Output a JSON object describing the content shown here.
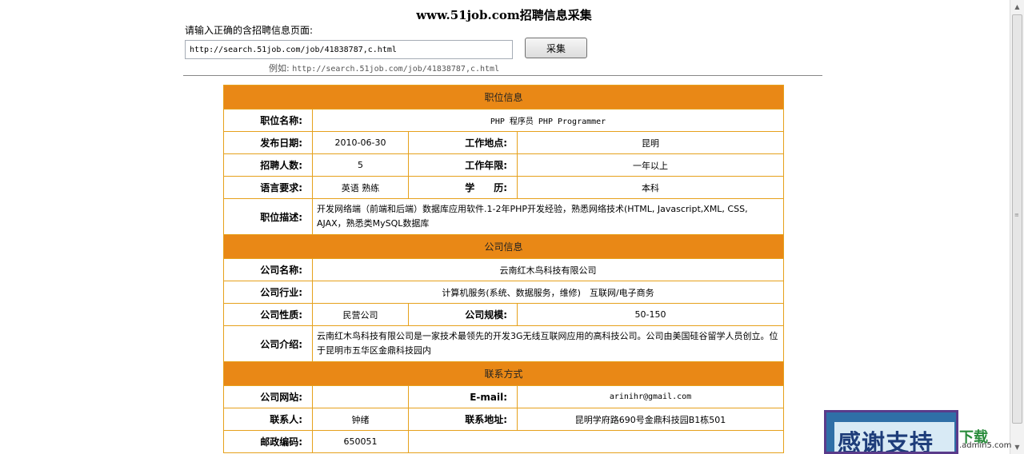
{
  "header": {
    "title": "www.51job.com招聘信息采集",
    "prompt": "请输入正确的含招聘信息页面:",
    "url_value": "http://search.51job.com/job/41838787,c.html",
    "collect_label": "采集",
    "example_label": "例如:",
    "example_url": "http://search.51job.com/job/41838787,c.html"
  },
  "job": {
    "section_title": "职位信息",
    "name_label": "职位名称:",
    "name_value": "PHP 程序员 PHP Programmer",
    "date_label": "发布日期:",
    "date_value": "2010-06-30",
    "location_label": "工作地点:",
    "location_value": "昆明",
    "count_label": "招聘人数:",
    "count_value": "5",
    "years_label": "工作年限:",
    "years_value": "一年以上",
    "language_label": "语言要求:",
    "language_value": "英语 熟练",
    "education_label": "学　　历:",
    "education_value": "本科",
    "desc_label": "职位描述:",
    "desc_value": "开发网络端（前端和后端）数据库应用软件.1-2年PHP开发经验，熟悉网络技术(HTML, Javascript,XML, CSS, AJAX，熟悉类MySQL数据库"
  },
  "company": {
    "section_title": "公司信息",
    "name_label": "公司名称:",
    "name_value": "云南红木鸟科技有限公司",
    "industry_label": "公司行业:",
    "industry_value": "计算机服务(系统、数据服务，维修)　互联网/电子商务",
    "nature_label": "公司性质:",
    "nature_value": "民营公司",
    "size_label": "公司规模:",
    "size_value": "50-150",
    "intro_label": "公司介绍:",
    "intro_value": "云南红木鸟科技有限公司是一家技术最领先的开发3G无线互联网应用的高科技公司。公司由美国硅谷留学人员创立。位于昆明市五华区金鼎科技园内"
  },
  "contact": {
    "section_title": "联系方式",
    "website_label": "公司网站:",
    "website_value": "",
    "email_label": "E-mail:",
    "email_value": "arinihr@gmail.com",
    "person_label": "联系人:",
    "person_value": "钟绪",
    "address_label": "联系地址:",
    "address_value": "昆明学府路690号金鼎科技园B1栋501",
    "zip_label": "邮政编码:",
    "zip_value": "650051"
  },
  "banner": {
    "text": "感谢支持",
    "brand_main": "下载",
    "brand_sub": ".admin5.com"
  },
  "theme": {
    "section_color": "#e98816",
    "border_color": "#e6a11c"
  }
}
